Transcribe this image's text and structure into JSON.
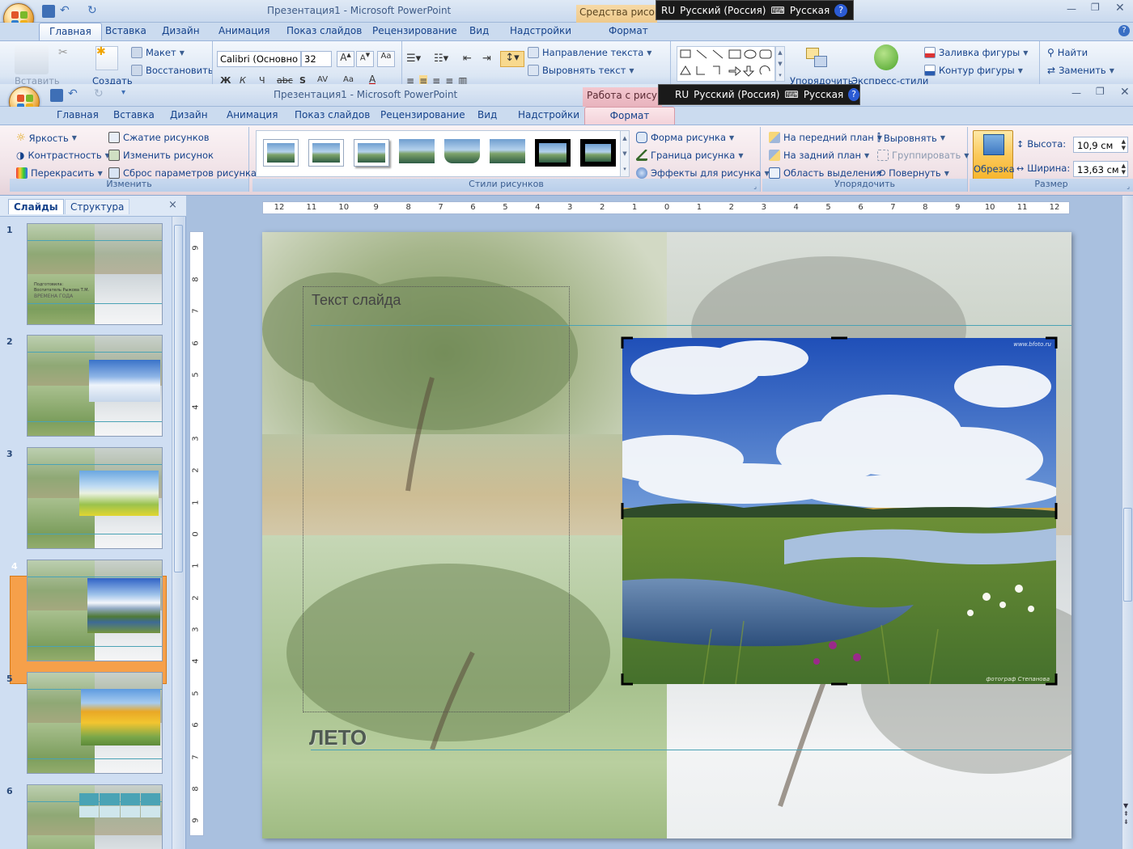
{
  "back_window": {
    "title": "Презентация1 - Microsoft PowerPoint",
    "context_tab": "Средства рисова",
    "tabs": [
      "Главная",
      "Вставка",
      "Дизайн",
      "Анимация",
      "Показ слайдов",
      "Рецензирование",
      "Вид",
      "Надстройки"
    ],
    "context_subtab": "Формат",
    "active_tab": "Главная",
    "ribbon": {
      "paste": "Вставить",
      "create": "Создать",
      "layout": "Макет",
      "restore": "Восстановить",
      "font_name": "Calibri (Основно",
      "font_size": "32",
      "text_direction": "Направление текста",
      "align_text": "Выровнять текст",
      "arrange": "Упорядочить",
      "quick_styles": "Экспресс-стили",
      "shape_fill": "Заливка фигуры",
      "shape_outline": "Контур фигуры",
      "find": "Найти",
      "replace": "Заменить",
      "bold": "Ж",
      "italic": "К",
      "underline": "Ч",
      "strike": "abc",
      "shadow": "S",
      "spacing": "AV",
      "case": "Aa",
      "font_color": "A"
    },
    "language": {
      "code": "RU",
      "name": "Русский (Россия)",
      "keyboard": "Русская"
    }
  },
  "window": {
    "title": "Презентация1 - Microsoft PowerPoint",
    "context_tab": "Работа с рисунк",
    "tabs": [
      "Главная",
      "Вставка",
      "Дизайн",
      "Анимация",
      "Показ слайдов",
      "Рецензирование",
      "Вид",
      "Надстройки"
    ],
    "active_tab": "Формат",
    "language": {
      "code": "RU",
      "name": "Русский (Россия)",
      "keyboard": "Русская"
    }
  },
  "ribbon": {
    "adjust": {
      "label": "Изменить",
      "brightness": "Яркость",
      "contrast": "Контрастность",
      "recolor": "Перекрасить",
      "compress": "Сжатие рисунков",
      "change": "Изменить рисунок",
      "reset": "Сброс параметров рисунка"
    },
    "styles": {
      "label": "Стили рисунков",
      "shape": "Форма рисунка",
      "border": "Граница рисунка",
      "effects": "Эффекты для рисунка"
    },
    "arrange": {
      "label": "Упорядочить",
      "front": "На передний план",
      "back": "На задний план",
      "selection": "Область выделения",
      "align": "Выровнять",
      "group": "Группировать",
      "rotate": "Повернуть"
    },
    "size": {
      "label": "Размер",
      "crop": "Обрезка",
      "height_label": "Высота:",
      "height": "10,9 см",
      "width_label": "Ширина:",
      "width": "13,63 см"
    }
  },
  "panel": {
    "tabs": [
      "Слайды",
      "Структура"
    ],
    "close": "×",
    "slides": [
      "1",
      "2",
      "3",
      "4",
      "5",
      "6"
    ],
    "selected": 4,
    "slide1_text": [
      "Подготовила:",
      "Воспитатель Рыжова Т.М.",
      "ВРЕМЕНА ГОДА"
    ]
  },
  "ruler": {
    "h": [
      "12",
      "11",
      "10",
      "9",
      "8",
      "7",
      "6",
      "5",
      "4",
      "3",
      "2",
      "1",
      "0",
      "1",
      "2",
      "3",
      "4",
      "5",
      "6",
      "7",
      "8",
      "9",
      "10",
      "11",
      "12"
    ],
    "v": [
      "9",
      "8",
      "7",
      "6",
      "5",
      "4",
      "3",
      "2",
      "1",
      "0",
      "1",
      "2",
      "3",
      "4",
      "5",
      "6",
      "7",
      "8",
      "9"
    ]
  },
  "slide": {
    "placeholder": "Текст слайда",
    "title": "ЛЕТО",
    "watermark_top": "www.bfoto.ru",
    "watermark_bottom": "фотограф Степанова"
  },
  "colors": {
    "context_tab": "#e8b3bd",
    "selected_thumb": "#f6a04a",
    "accent_line": "#4aa3b5"
  }
}
